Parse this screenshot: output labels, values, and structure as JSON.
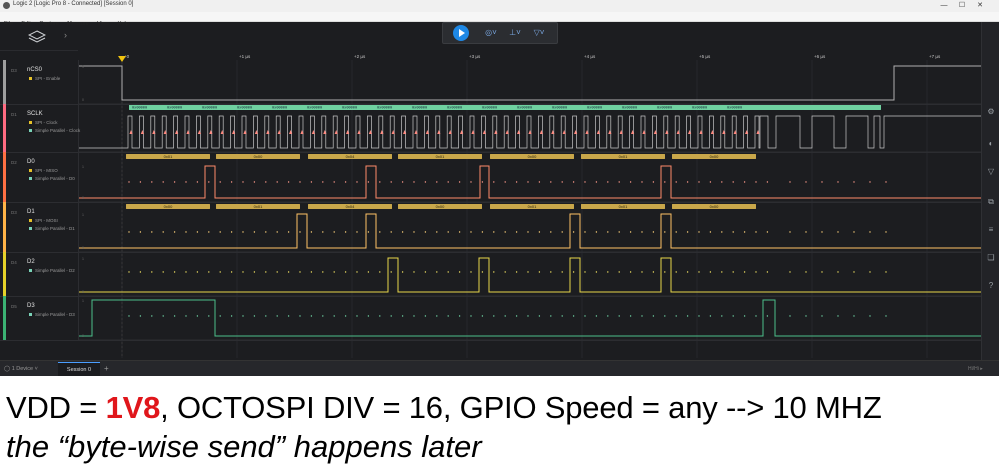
{
  "window": {
    "title": "Logic 2 [Logic Pro 8 - Connected] [Session 0]",
    "controls": [
      "—",
      "☐",
      "✕"
    ]
  },
  "menu": [
    "File",
    "Edit",
    "Capture",
    "Measure",
    "View",
    "Help"
  ],
  "toolbar": {
    "play_icon": "play-icon",
    "icons": [
      "chevron-measure-icon",
      "trigger-icon",
      "marker-icon"
    ]
  },
  "timeline": {
    "labels": [
      "+0",
      "+1 µs",
      "+2 µs",
      "+3 µs",
      "+4 µs",
      "+5 µs",
      "+6 µs",
      "+7 µs"
    ]
  },
  "channels": [
    {
      "index": "D3",
      "name": "nCS0",
      "color": "#9e9e9e",
      "analyzers": [
        {
          "label": "SPI - Enable",
          "color": "#e6c229"
        }
      ]
    },
    {
      "index": "D1",
      "name": "SCLK",
      "color": "#ff6b81",
      "analyzers": [
        {
          "label": "SPI - Clock",
          "color": "#e6c229"
        },
        {
          "label": "Simple Parallel - Clock",
          "color": "#7ad3b8"
        }
      ]
    },
    {
      "index": "D2",
      "name": "D0",
      "color": "#ff7043",
      "analyzers": [
        {
          "label": "SPI - MISO",
          "color": "#e6c229"
        },
        {
          "label": "Simple Parallel - D0",
          "color": "#7ad3b8"
        }
      ]
    },
    {
      "index": "D3",
      "name": "D1",
      "color": "#ffb347",
      "analyzers": [
        {
          "label": "SPI - MOSI",
          "color": "#e6c229"
        },
        {
          "label": "Simple Parallel - D1",
          "color": "#7ad3b8"
        }
      ]
    },
    {
      "index": "D4",
      "name": "D2",
      "color": "#e6d229",
      "analyzers": [
        {
          "label": "Simple Parallel - D2",
          "color": "#7ad3b8"
        }
      ]
    },
    {
      "index": "D5",
      "name": "D3",
      "color": "#3bb273",
      "analyzers": [
        {
          "label": "Simple Parallel - D3",
          "color": "#7ad3b8"
        }
      ]
    }
  ],
  "decoded": {
    "d0_bytes": [
      "0x01",
      "0x00",
      "0x04",
      "0x01",
      "0x00",
      "0x01",
      "0x00"
    ],
    "d1_bytes": [
      "0x00",
      "0x01",
      "0x04",
      "0x00",
      "0x01",
      "0x01",
      "0x00"
    ],
    "sclk_word": "0x00000"
  },
  "bottom": {
    "device": "1 Device",
    "session_tab": "Session 0",
    "add_tab": "+",
    "corner": "Hi/Hi ▸"
  },
  "caption": {
    "line1_prefix": "VDD = ",
    "line1_highlight": "1V8",
    "line1_suffix": ", OCTOSPI DIV = 16, GPIO Speed = any --> 10 MHZ",
    "line2": "the “byte-wise send” happens later"
  },
  "colors": {
    "background": "#1c1d20",
    "accent": "#1e88e5",
    "highlight_red": "#e0161b",
    "byte_box": "#c9a74a",
    "sclk_box": "#6fd1a0"
  }
}
